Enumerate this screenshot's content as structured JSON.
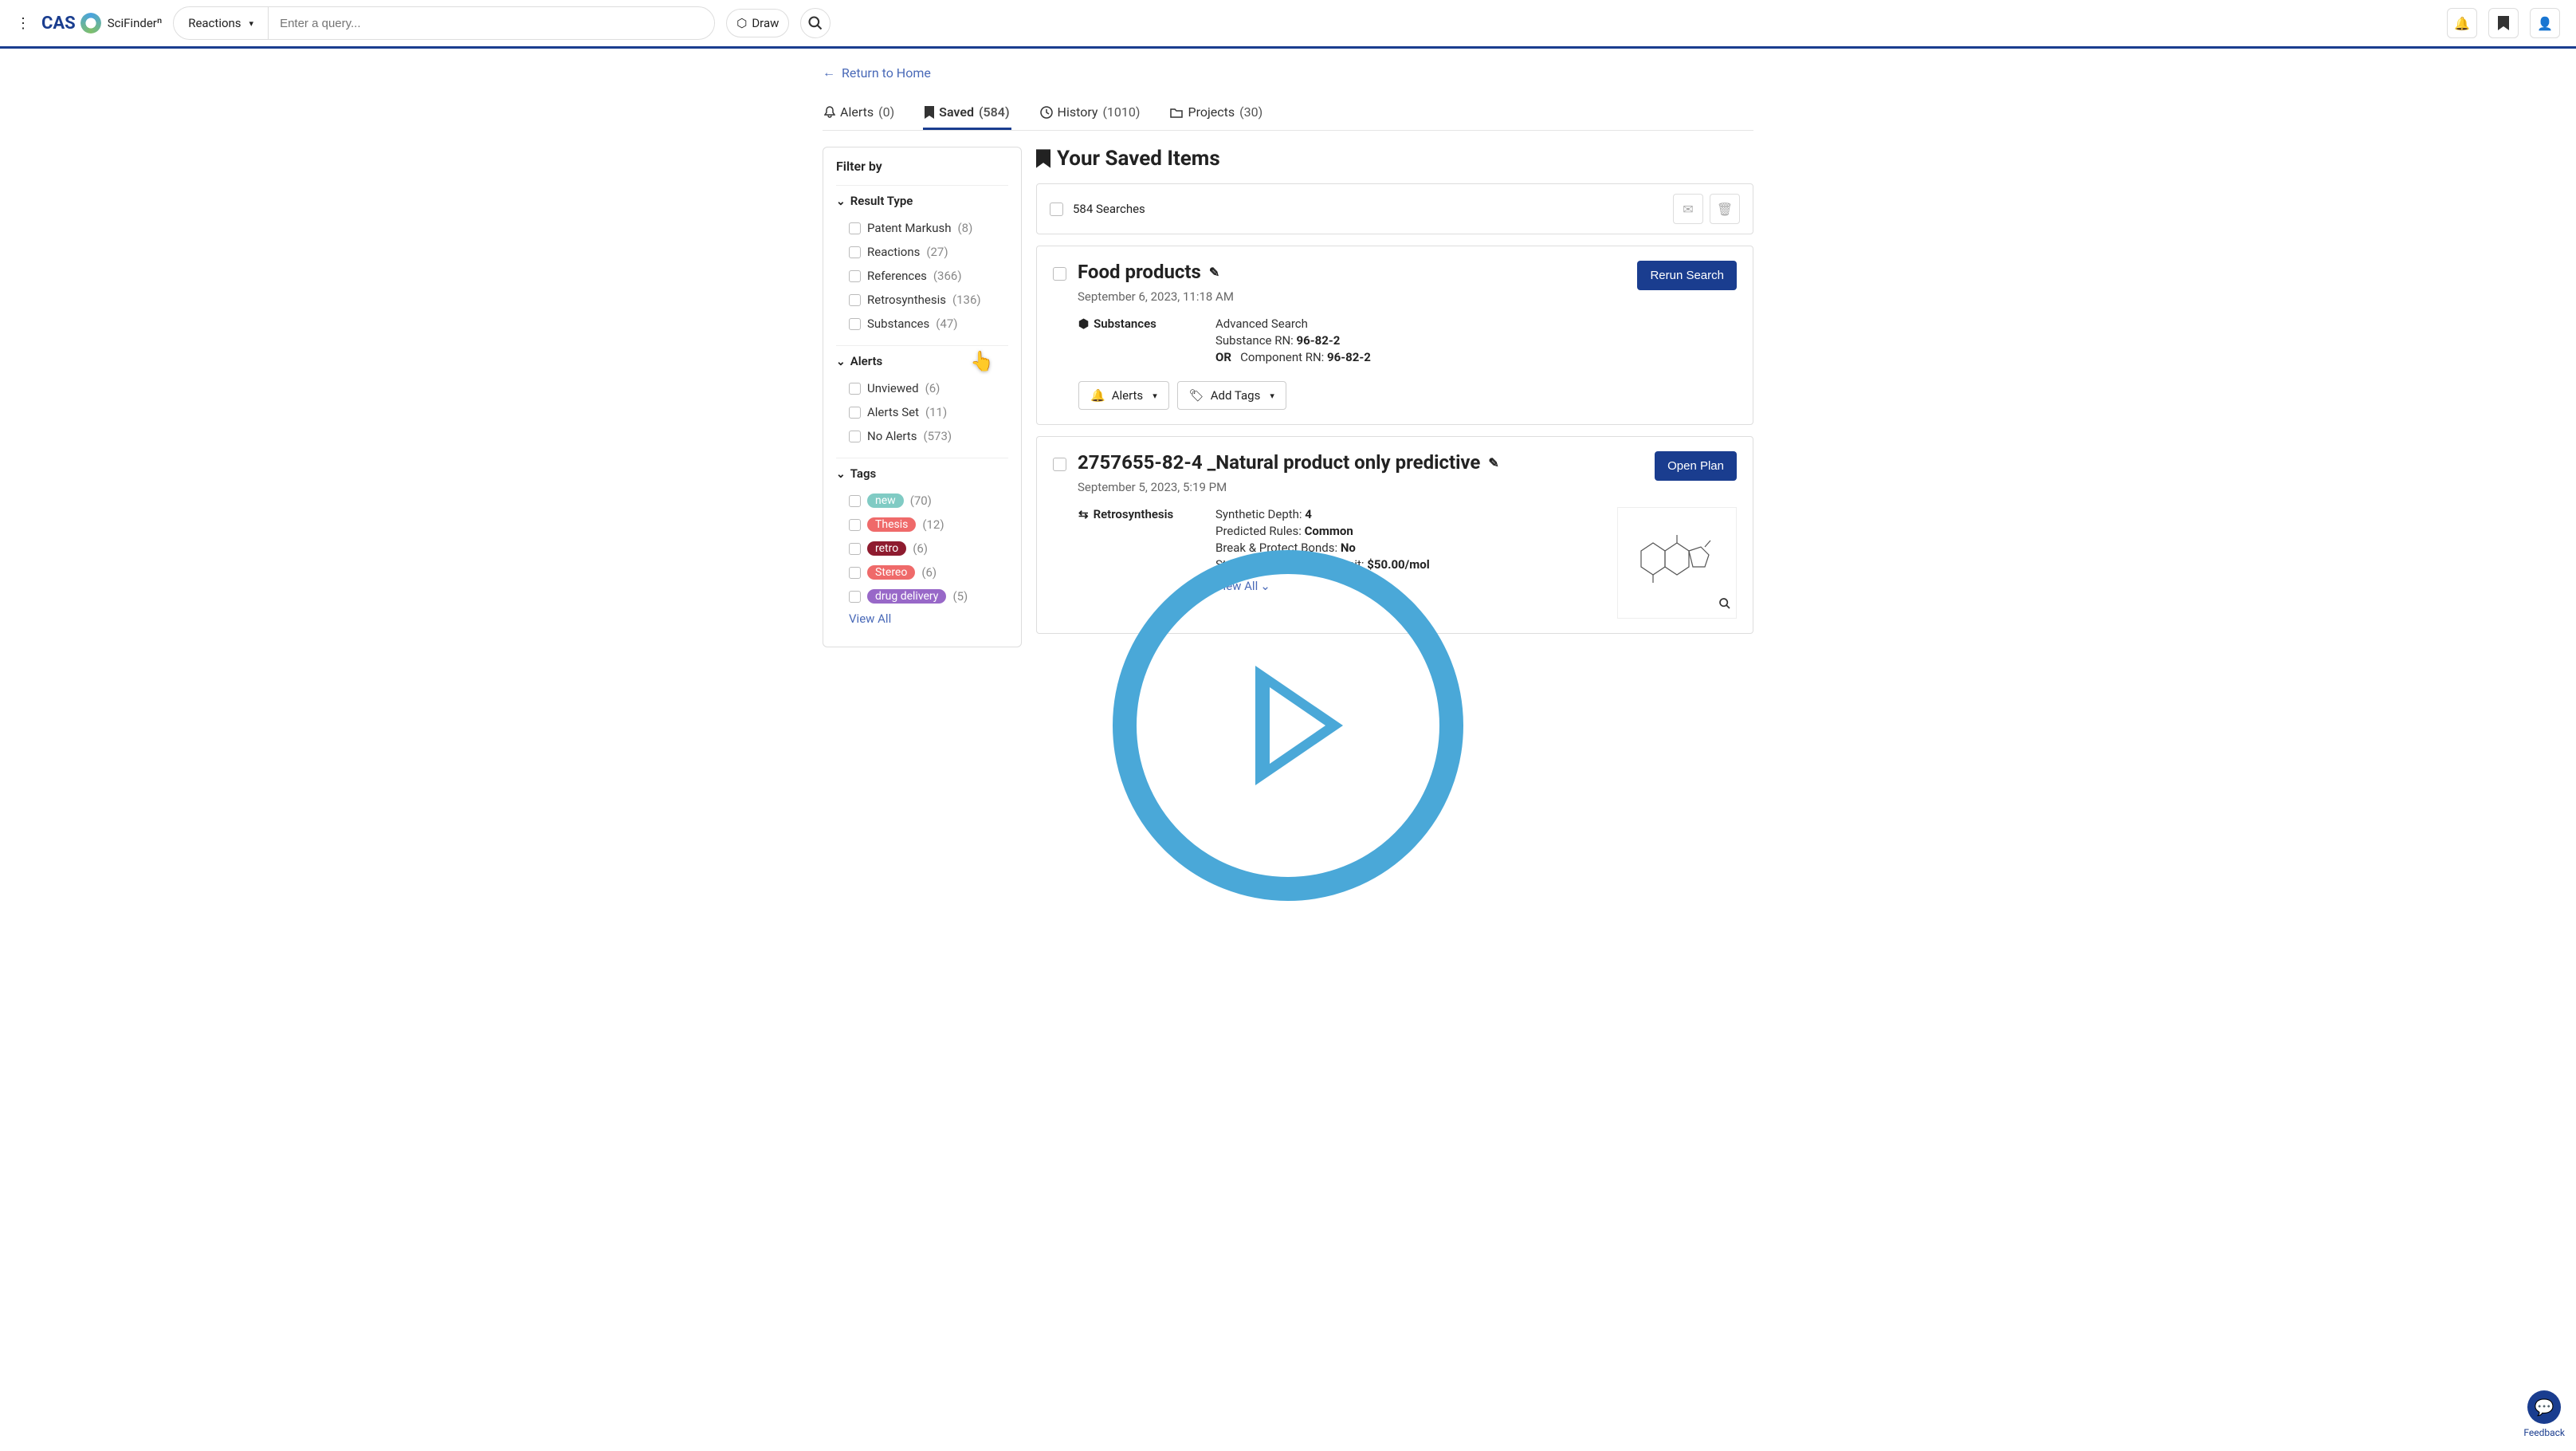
{
  "header": {
    "searchType": "Reactions",
    "searchPlaceholder": "Enter a query...",
    "drawLabel": "Draw"
  },
  "nav": {
    "returnLabel": "Return to Home",
    "tabs": [
      {
        "label": "Alerts",
        "count": "(0)"
      },
      {
        "label": "Saved",
        "count": "(584)"
      },
      {
        "label": "History",
        "count": "(1010)"
      },
      {
        "label": "Projects",
        "count": "(30)"
      }
    ]
  },
  "sidebar": {
    "title": "Filter by",
    "sections": {
      "resultType": {
        "title": "Result Type",
        "items": [
          {
            "label": "Patent Markush",
            "count": "(8)"
          },
          {
            "label": "Reactions",
            "count": "(27)"
          },
          {
            "label": "References",
            "count": "(366)"
          },
          {
            "label": "Retrosynthesis",
            "count": "(136)"
          },
          {
            "label": "Substances",
            "count": "(47)"
          }
        ]
      },
      "alerts": {
        "title": "Alerts",
        "items": [
          {
            "label": "Unviewed",
            "count": "(6)"
          },
          {
            "label": "Alerts Set",
            "count": "(11)"
          },
          {
            "label": "No Alerts",
            "count": "(573)"
          }
        ]
      },
      "tags": {
        "title": "Tags",
        "items": [
          {
            "label": "new",
            "count": "(70)",
            "color": "#80cbc4"
          },
          {
            "label": "Thesis",
            "count": "(12)",
            "color": "#ef6a6a"
          },
          {
            "label": "retro",
            "count": "(6)",
            "color": "#8e1b2f"
          },
          {
            "label": "Stereo",
            "count": "(6)",
            "color": "#ef6a6a"
          },
          {
            "label": "drug delivery",
            "count": "(5)",
            "color": "#9868c8"
          }
        ],
        "viewAll": "View All"
      }
    }
  },
  "main": {
    "title": "Your Saved Items",
    "selectAllLabel": "584 Searches",
    "alertsBtnLabel": "Alerts",
    "addTagsLabel": "Add Tags",
    "rerunLabel": "Rerun Search",
    "openPlanLabel": "Open Plan",
    "viewAllLabel": "View All",
    "cards": [
      {
        "title": "Food products",
        "date": "September 6, 2023, 11:18 AM",
        "type": "Substances",
        "detailsTitle": "Advanced Search",
        "line1Label": "Substance RN:",
        "line1Val": "96-82-2",
        "orLabel": "OR",
        "line2Label": "Component RN:",
        "line2Val": "96-82-2"
      },
      {
        "title": "2757655-82-4 _Natural product only predictive",
        "date": "September 5, 2023, 5:19 PM",
        "type": "Retrosynthesis",
        "d1l": "Synthetic Depth:",
        "d1v": "4",
        "d2l": "Predicted Rules:",
        "d2v": "Common",
        "d3l": "Break & Protect Bonds:",
        "d3v": "No",
        "d4l": "Starting Material Cost Limit:",
        "d4v": "$50.00/mol"
      }
    ]
  },
  "feedback": {
    "label": "Feedback"
  },
  "logo": {
    "cas": "CAS",
    "scifinder": "SciFinderⁿ"
  }
}
